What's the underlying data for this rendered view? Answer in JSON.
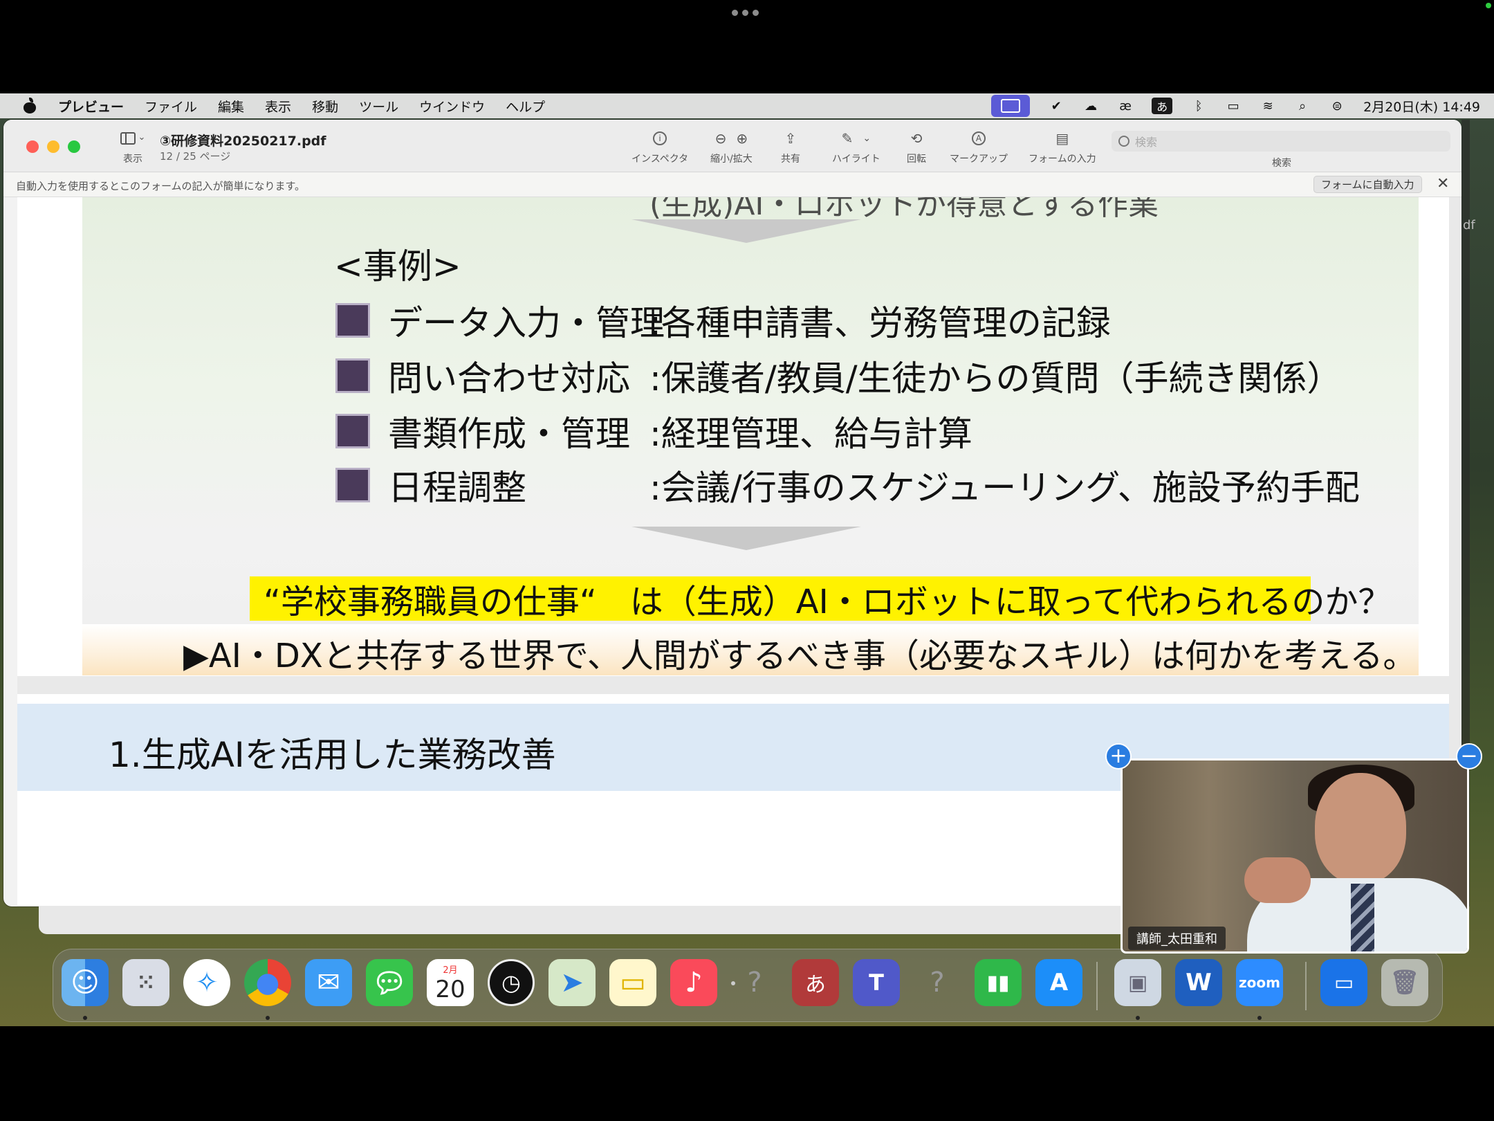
{
  "menubar": {
    "app_name": "プレビュー",
    "items": [
      "ファイル",
      "編集",
      "表示",
      "移動",
      "ツール",
      "ウインドウ",
      "ヘルプ"
    ],
    "ime_label": "あ",
    "status_icons": [
      "screen-share-icon",
      "check-circle-icon",
      "icloud-icon",
      "ae-icon",
      "ime-icon",
      "bluetooth-icon",
      "battery-icon",
      "wifi-icon",
      "spotlight-icon",
      "control-center-icon"
    ],
    "clock": "2月20日(木) 14:49"
  },
  "window": {
    "title": "③研修資料20250217.pdf",
    "page_info": "12 / 25 ページ",
    "toolbar": {
      "view_label": "表示",
      "inspector_label": "インスペクタ",
      "zoom_label": "縮小/拡大",
      "share_label": "共有",
      "highlight_label": "ハイライト",
      "rotate_label": "回転",
      "markup_label": "マークアップ",
      "form_label": "フォームの入力",
      "search_placeholder": "検索",
      "search_label": "検索"
    },
    "autofill": {
      "message": "自動入力を使用するとこのフォームの記入が簡単になります。",
      "button": "フォームに自動入力"
    },
    "side_cut_label": "df"
  },
  "slide": {
    "cut_top_text": "(生成)AI・ロボットが得意とする作業",
    "example_title": "<事例>",
    "examples": [
      {
        "key": "データ入力・管理",
        "value": ":各種申請書、労務管理の記録"
      },
      {
        "key": "問い合わせ対応",
        "value": ":保護者/教員/生徒からの質問（手続き関係）"
      },
      {
        "key": "書類作成・管理",
        "value": ":経理管理、給与計算"
      },
      {
        "key": "日程調整",
        "value": ":会議/行事のスケジューリング、施設予約手配"
      }
    ],
    "question": "“学校事務職員の仕事“　は（生成）AI・ロボットに取って代わられるのか？",
    "conclusion": "▶AI・DXと共存する世界で、人間がするべき事（必要なスキル）は何かを考える。",
    "colors": {
      "highlight": "#fff200",
      "bullet": "#4a3a5a",
      "section_band": "#dce9f6"
    }
  },
  "slide2": {
    "title": "1.生成AIを活用した業務改善"
  },
  "webcam": {
    "name": "講師_太田重和",
    "add_button": "+",
    "minimize_button": "−"
  },
  "dock": {
    "calendar_month": "2月",
    "calendar_day": "20",
    "ime_char": "あ",
    "zoom_label": "zoom",
    "word_label": "W",
    "icons": [
      "finder-icon",
      "launchpad-icon",
      "safari-icon",
      "chrome-icon",
      "mail-icon",
      "messages-icon",
      "calendar-icon",
      "clock-icon",
      "maps-icon",
      "notes-icon",
      "music-icon",
      "unknown-app-icon",
      "dictionary-icon",
      "teams-icon",
      "unknown-app-icon",
      "numbers-icon",
      "app-store-icon",
      "preview-icon",
      "word-icon",
      "zoom-icon",
      "zoom-screen-icon",
      "trash-icon"
    ]
  }
}
